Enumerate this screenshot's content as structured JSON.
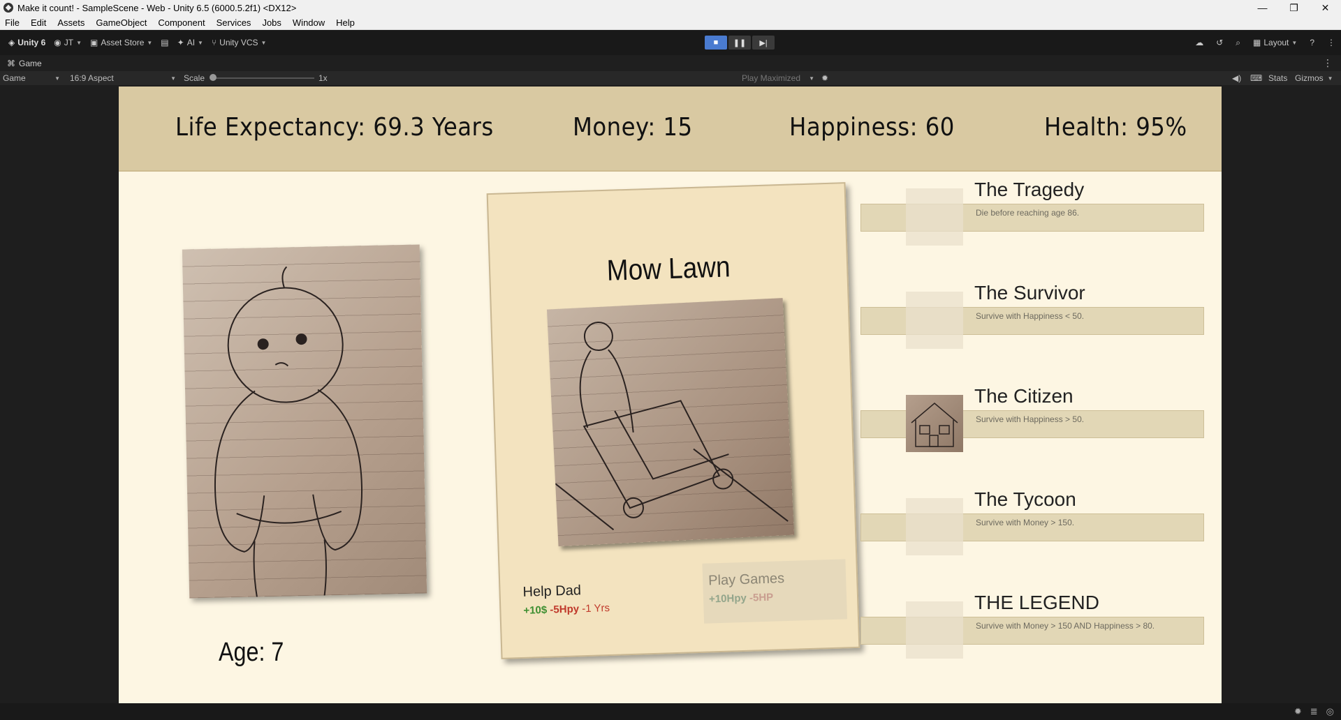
{
  "window": {
    "title": "Make it count! - SampleScene - Web - Unity 6.5 (6000.5.2f1) <DX12>",
    "minimize": "—",
    "maximize": "❐",
    "close": "✕"
  },
  "menu": [
    "File",
    "Edit",
    "Assets",
    "GameObject",
    "Component",
    "Services",
    "Jobs",
    "Window",
    "Help"
  ],
  "toolbar": {
    "unity": "Unity 6",
    "account": "JT",
    "asset_store": "Asset Store",
    "ai": "AI",
    "vcs": "Unity VCS",
    "layout": "Layout"
  },
  "tab": {
    "label": "Game"
  },
  "gamebar": {
    "display": "Game",
    "aspect": "16:9 Aspect",
    "scale_label": "Scale",
    "scale_value": "1x",
    "play_mode": "Play Maximized",
    "stats": "Stats",
    "gizmos": "Gizmos"
  },
  "hud": {
    "life": "Life Expectancy: 69.3 Years",
    "money": "Money: 15",
    "happiness": "Happiness: 60",
    "health": "Health: 95%"
  },
  "character": {
    "age": "Age: 7"
  },
  "card": {
    "title": "Mow Lawn",
    "left_choice": {
      "title": "Help Dad",
      "money": "+10$",
      "hpy": "-5Hpy",
      "yrs": "-1 Yrs"
    },
    "right_choice": {
      "title": "Play Games",
      "hpy": "+10Hpy",
      "hp": "-5HP"
    }
  },
  "achievements": [
    {
      "title": "The Tragedy",
      "desc": "Die before reaching age 86."
    },
    {
      "title": "The Survivor",
      "desc": "Survive with Happiness < 50."
    },
    {
      "title": "The Citizen",
      "desc": "Survive with Happiness > 50."
    },
    {
      "title": "The Tycoon",
      "desc": "Survive with Money > 150."
    },
    {
      "title": "THE LEGEND",
      "desc": "Survive with Money > 150 AND Happiness > 80."
    }
  ]
}
